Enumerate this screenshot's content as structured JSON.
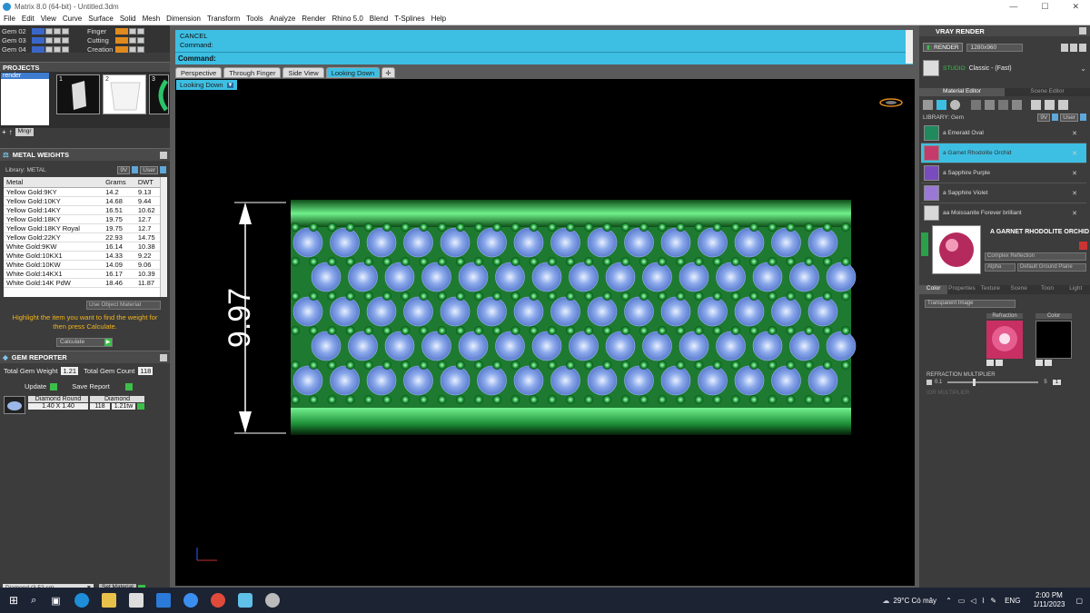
{
  "window": {
    "title": "Matrix 8.0 (64-bit) - Untitled.3dm",
    "controls": [
      "—",
      "☐",
      "✕"
    ]
  },
  "menu": [
    "File",
    "Edit",
    "View",
    "Curve",
    "Surface",
    "Solid",
    "Mesh",
    "Dimension",
    "Transform",
    "Tools",
    "Analyze",
    "Render",
    "Rhino 5.0",
    "Blend",
    "T-Splines",
    "Help"
  ],
  "gems": {
    "rows": [
      {
        "label": "Gem 02"
      },
      {
        "label": "Gem 03"
      },
      {
        "label": "Gem 04"
      }
    ],
    "right_labels": [
      "Finger",
      "Cutting",
      "Creation"
    ]
  },
  "projects": {
    "title": "PROJECTS",
    "item": "render",
    "thumbs": [
      "1",
      "2",
      "3"
    ],
    "mngr": "Mngr"
  },
  "metal_weights": {
    "title": "METAL WEIGHTS",
    "library": "Library: METAL",
    "lib_btns": [
      "9V",
      "User"
    ],
    "headers": [
      "Metal",
      "Grams",
      "DWT"
    ],
    "rows": [
      [
        "Yellow Gold:9KY",
        "14.2",
        "9.13"
      ],
      [
        "Yellow Gold:10KY",
        "14.68",
        "9.44"
      ],
      [
        "Yellow Gold:14KY",
        "16.51",
        "10.62"
      ],
      [
        "Yellow Gold:18KY",
        "19.75",
        "12.7"
      ],
      [
        "Yellow Gold:18KY Royal",
        "19.75",
        "12.7"
      ],
      [
        "Yellow Gold:22KY",
        "22.93",
        "14.75"
      ],
      [
        "White Gold:9KW",
        "16.14",
        "10.38"
      ],
      [
        "White Gold:10KX1",
        "14.33",
        "9.22"
      ],
      [
        "White Gold:10KW",
        "14.09",
        "9.06"
      ],
      [
        "White Gold:14KX1",
        "16.17",
        "10.39"
      ],
      [
        "White Gold:14K PdW",
        "18.46",
        "11.87"
      ]
    ],
    "use_object_material": "Use Object Material",
    "hint": "Highlight the item you want to find the weight for then press Calculate.",
    "calculate": "Calculate"
  },
  "gem_reporter": {
    "title": "GEM REPORTER",
    "total_weight_label": "Total Gem Weight",
    "total_weight": "1.21",
    "total_count_label": "Total Gem Count",
    "total_count": "118",
    "update": "Update",
    "save_report": "Save Report",
    "item": {
      "shape": "Diamond Round",
      "material": "Diamond",
      "size": "1.40 X 1.40",
      "count": "118",
      "ctw": "1.21tw"
    }
  },
  "bottom_left": {
    "dropdown": "Diamond   (3.52 sg)",
    "set_material": "Set Material"
  },
  "command": {
    "cancel": "CANCEL",
    "line1": "Command:",
    "prompt": "Command:"
  },
  "viewport_tabs": [
    "Perspective",
    "Through Finger",
    "Side View",
    "Looking Down"
  ],
  "active_view": "Looking Down",
  "dimension": "9.97",
  "vray": {
    "title": "VRAY RENDER",
    "render": "RENDER",
    "resolution": "1280x960",
    "studio": "STUDIO",
    "preset": "Classic - (Fast)",
    "tabs": [
      "Material Editor",
      "Scene Editor"
    ],
    "library": "LIBRARY: Gem",
    "lib_btns": [
      "9V",
      "User"
    ],
    "materials": [
      {
        "name": "a Emerald Oval",
        "color": "#1f8a5e"
      },
      {
        "name": "a Garnet Rhodolite Orchid",
        "color": "#c43a6b"
      },
      {
        "name": "a Sapphire Purple",
        "color": "#7a4bbf"
      },
      {
        "name": "a Sapphire Violet",
        "color": "#9a79d6"
      },
      {
        "name": "aa Moissanite Forever brilliant",
        "color": "#d8d8d8"
      }
    ],
    "selected_material": "A GARNET RHODOLITE ORCHID",
    "mat_type": "Complex Reflection",
    "alpha": "Alpha",
    "ground": "Default Ground Plane",
    "prop_tabs": [
      "Color",
      "Properties",
      "Texture",
      "Scene",
      "Toon",
      "Light"
    ],
    "transparent": "Transparent Image",
    "refraction_label": "Refraction",
    "color_label": "Color",
    "refraction_multiplier": "REFRACTION MULTIPLIER",
    "mult_min": "0.1",
    "mult_max": "5",
    "mult_val": "1",
    "ior_label": "IOR MULTIPLIER"
  },
  "taskbar": {
    "weather": "29°C Có mây",
    "lang": "ENG",
    "time": "2:00 PM",
    "date": "1/11/2023"
  }
}
